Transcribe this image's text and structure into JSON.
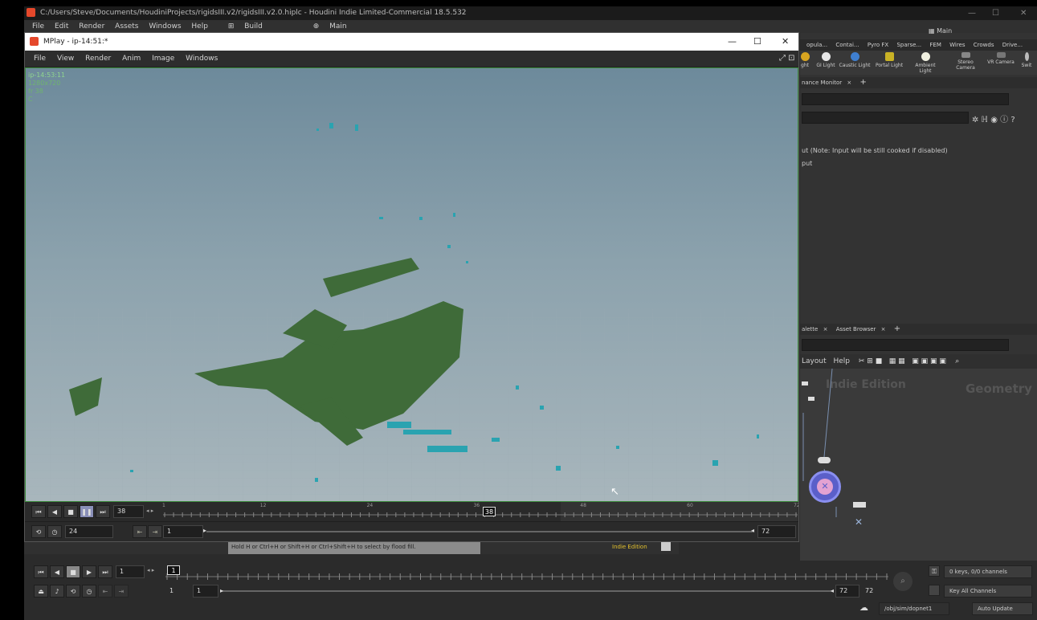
{
  "app": {
    "title": "C:/Users/Steve/Documents/HoudiniProjects/rigidsIII.v2/rigidsIII.v2.0.hiplc - Houdini Indie Limited-Commercial 18.5.532",
    "menu": [
      "File",
      "Edit",
      "Render",
      "Assets",
      "Windows",
      "Help"
    ],
    "desktop_build": "Build",
    "desktop_main": "Main",
    "right_main": "Main"
  },
  "shelf": {
    "tabs": [
      "opula...",
      "Contai...",
      "Pyro FX",
      "Sparse...",
      "FEM",
      "Wires",
      "Crowds",
      "Drive..."
    ],
    "tools": [
      {
        "label": "ght",
        "icon": "light-icon"
      },
      {
        "label": "GI Light",
        "icon": "gi-light-icon"
      },
      {
        "label": "Caustic Light",
        "icon": "caustic-light-icon"
      },
      {
        "label": "Portal Light",
        "icon": "portal-light-icon"
      },
      {
        "label": "Ambient Light",
        "icon": "ambient-light-icon"
      },
      {
        "label": "Stereo Camera",
        "icon": "stereo-camera-icon"
      },
      {
        "label": "VR Camera",
        "icon": "vr-camera-icon"
      },
      {
        "label": "Swit",
        "icon": "switcher-icon"
      }
    ]
  },
  "params": {
    "tab_label": "nance Monitor",
    "line1": "ut (Note: Input will be still cooked if disabled)",
    "line2": "put"
  },
  "network": {
    "tabs": [
      "alette",
      "Asset Browser"
    ],
    "menu": [
      "Layout",
      "Help"
    ],
    "watermark_left": "Indie Edition",
    "watermark_right": "Geometry"
  },
  "mplay": {
    "title": "MPlay - ip-14:51:*",
    "menu": [
      "File",
      "View",
      "Render",
      "Anim",
      "Image",
      "Windows"
    ],
    "info": [
      "ip-14:53:11",
      "1280x720",
      "fr 38",
      "C"
    ],
    "frame": "38",
    "fps": "24",
    "range_start": "1",
    "range_end": "72",
    "ticks": [
      "1",
      "12",
      "24",
      "36",
      "48",
      "60",
      "72"
    ],
    "current_marker": "38"
  },
  "status": {
    "hint": "Hold H or Ctrl+H or Shift+H or Ctrl+Shift+H to select by flood fill.",
    "edition": "Indie Edition"
  },
  "timeline": {
    "frame": "1",
    "current_marker": "1",
    "start": "1",
    "start2": "1",
    "end": "72",
    "end2": "72",
    "keys": "0 keys, 0/0 channels",
    "key_all": "Key All Channels",
    "path": "/obj/sim/dopnet1",
    "update": "Auto Update"
  }
}
